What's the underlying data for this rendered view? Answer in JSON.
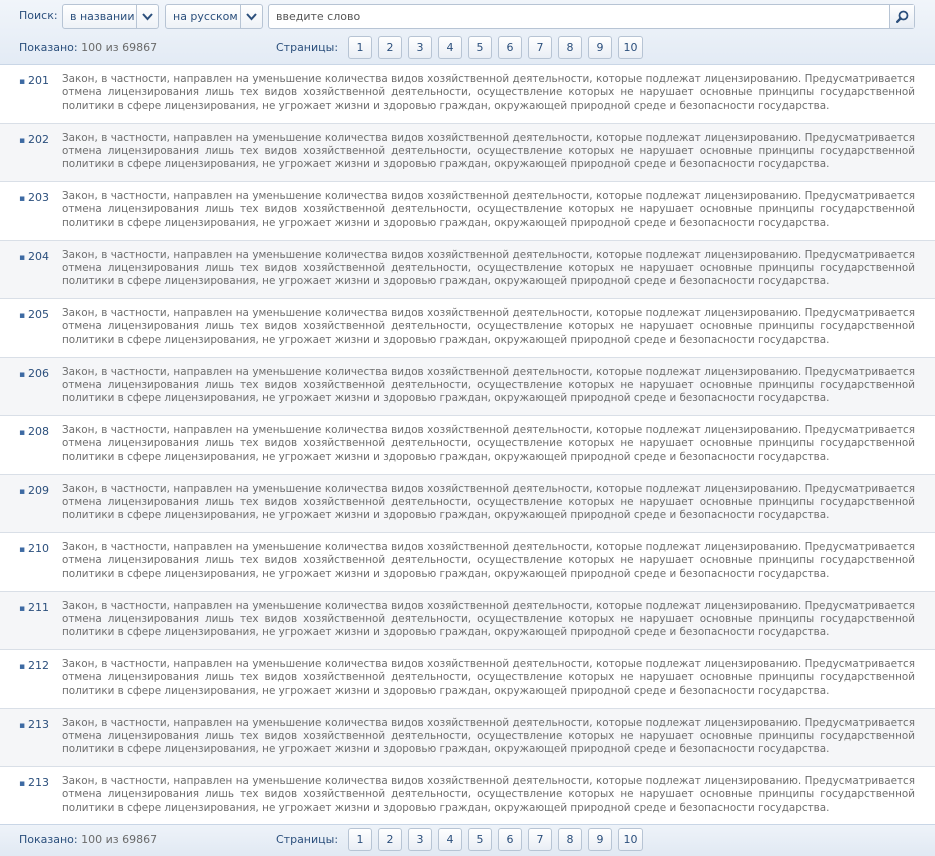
{
  "search": {
    "label": "Поиск:",
    "scope_value": "в названии",
    "language_value": "на русском",
    "placeholder": "введите слово"
  },
  "summary": {
    "label": "Показано:",
    "value": "100 из 69867"
  },
  "pager": {
    "label": "Страницы:",
    "pages": [
      "1",
      "2",
      "3",
      "4",
      "5",
      "6",
      "7",
      "8",
      "9",
      "10"
    ]
  },
  "items": [
    {
      "number": "201",
      "text": "Закон, в частности, направлен на уменьшение количества видов хозяйственной деятельности, которые подлежат лицензированию. Предусматривается отмена лицензирования лишь тех видов хозяйственной деятельности, осуществление которых не нарушает основные принципы государственной политики в сфере лицензирования, не угрожает жизни и здоровью граждан, окружающей природной среде и безопасности государства."
    },
    {
      "number": "202",
      "text": "Закон, в частности, направлен на уменьшение количества видов хозяйственной деятельности, которые подлежат лицензированию. Предусматривается отмена лицензирования лишь тех видов хозяйственной деятельности, осуществление которых не нарушает основные принципы государственной политики в сфере лицензирования, не угрожает жизни и здоровью граждан, окружающей природной среде и безопасности государства."
    },
    {
      "number": "203",
      "text": "Закон, в частности, направлен на уменьшение количества видов хозяйственной деятельности, которые подлежат лицензированию. Предусматривается отмена лицензирования лишь тех видов хозяйственной деятельности, осуществление которых не нарушает основные принципы государственной политики в сфере лицензирования, не угрожает жизни и здоровью граждан, окружающей природной среде и безопасности государства."
    },
    {
      "number": "204",
      "text": "Закон, в частности, направлен на уменьшение количества видов хозяйственной деятельности, которые подлежат лицензированию. Предусматривается отмена лицензирования лишь тех видов хозяйственной деятельности, осуществление которых не нарушает основные принципы государственной политики в сфере лицензирования, не угрожает жизни и здоровью граждан, окружающей природной среде и безопасности государства."
    },
    {
      "number": "205",
      "text": "Закон, в частности, направлен на уменьшение количества видов хозяйственной деятельности, которые подлежат лицензированию. Предусматривается отмена лицензирования лишь тех видов хозяйственной деятельности, осуществление которых не нарушает основные принципы государственной политики в сфере лицензирования, не угрожает жизни и здоровью граждан, окружающей природной среде и безопасности государства."
    },
    {
      "number": "206",
      "text": "Закон, в частности, направлен на уменьшение количества видов хозяйственной деятельности, которые подлежат лицензированию. Предусматривается отмена лицензирования лишь тех видов хозяйственной деятельности, осуществление которых не нарушает основные принципы государственной политики в сфере лицензирования, не угрожает жизни и здоровью граждан, окружающей природной среде и безопасности государства."
    },
    {
      "number": "208",
      "text": "Закон, в частности, направлен на уменьшение количества видов хозяйственной деятельности, которые подлежат лицензированию. Предусматривается отмена лицензирования лишь тех видов хозяйственной деятельности, осуществление которых не нарушает основные принципы государственной политики в сфере лицензирования, не угрожает жизни и здоровью граждан, окружающей природной среде и безопасности государства."
    },
    {
      "number": "209",
      "text": "Закон, в частности, направлен на уменьшение количества видов хозяйственной деятельности, которые подлежат лицензированию. Предусматривается отмена лицензирования лишь тех видов хозяйственной деятельности, осуществление которых не нарушает основные принципы государственной политики в сфере лицензирования, не угрожает жизни и здоровью граждан, окружающей природной среде и безопасности государства."
    },
    {
      "number": "210",
      "text": "Закон, в частности, направлен на уменьшение количества видов хозяйственной деятельности, которые подлежат лицензированию. Предусматривается отмена лицензирования лишь тех видов хозяйственной деятельности, осуществление которых не нарушает основные принципы государственной политики в сфере лицензирования, не угрожает жизни и здоровью граждан, окружающей природной среде и безопасности государства."
    },
    {
      "number": "211",
      "text": "Закон, в частности, направлен на уменьшение количества видов хозяйственной деятельности, которые подлежат лицензированию. Предусматривается отмена лицензирования лишь тех видов хозяйственной деятельности, осуществление которых не нарушает основные принципы государственной политики в сфере лицензирования, не угрожает жизни и здоровью граждан, окружающей природной среде и безопасности государства."
    },
    {
      "number": "212",
      "text": "Закон, в частности, направлен на уменьшение количества видов хозяйственной деятельности, которые подлежат лицензированию. Предусматривается отмена лицензирования лишь тех видов хозяйственной деятельности, осуществление которых не нарушает основные принципы государственной политики в сфере лицензирования, не угрожает жизни и здоровью граждан, окружающей природной среде и безопасности государства."
    },
    {
      "number": "213",
      "text": "Закон, в частности, направлен на уменьшение количества видов хозяйственной деятельности, которые подлежат лицензированию. Предусматривается отмена лицензирования лишь тех видов хозяйственной деятельности, осуществление которых не нарушает основные принципы государственной политики в сфере лицензирования, не угрожает жизни и здоровью граждан, окружающей природной среде и безопасности государства."
    },
    {
      "number": "213",
      "text": "Закон, в частности, направлен на уменьшение количества видов хозяйственной деятельности, которые подлежат лицензированию. Предусматривается отмена лицензирования лишь тех видов хозяйственной деятельности, осуществление которых не нарушает основные принципы государственной политики в сфере лицензирования, не угрожает жизни и здоровью граждан, окружающей природной среде и безопасности государства."
    }
  ],
  "icons": {
    "dropdown": "chevron-down-icon",
    "search": "magnifier-icon"
  },
  "colors": {
    "accent": "#2b4f7c",
    "border": "#b7c4d4",
    "text": "#6d6d6d"
  }
}
